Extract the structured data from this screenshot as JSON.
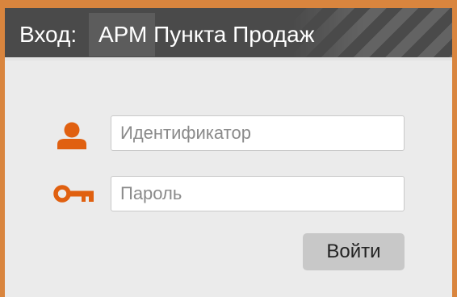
{
  "dialog": {
    "title_prefix": "Вход:",
    "title": "АРМ Пункта Продаж"
  },
  "form": {
    "username": {
      "icon": "user-icon",
      "placeholder": "Идентификатор",
      "value": ""
    },
    "password": {
      "icon": "key-icon",
      "placeholder": "Пароль",
      "value": ""
    },
    "submit_label": "Войти"
  },
  "colors": {
    "accent": "#d9853e",
    "icon": "#e06010",
    "titlebar": "#4a4a4a",
    "panel": "#ebebeb",
    "button": "#c8c8c8"
  }
}
